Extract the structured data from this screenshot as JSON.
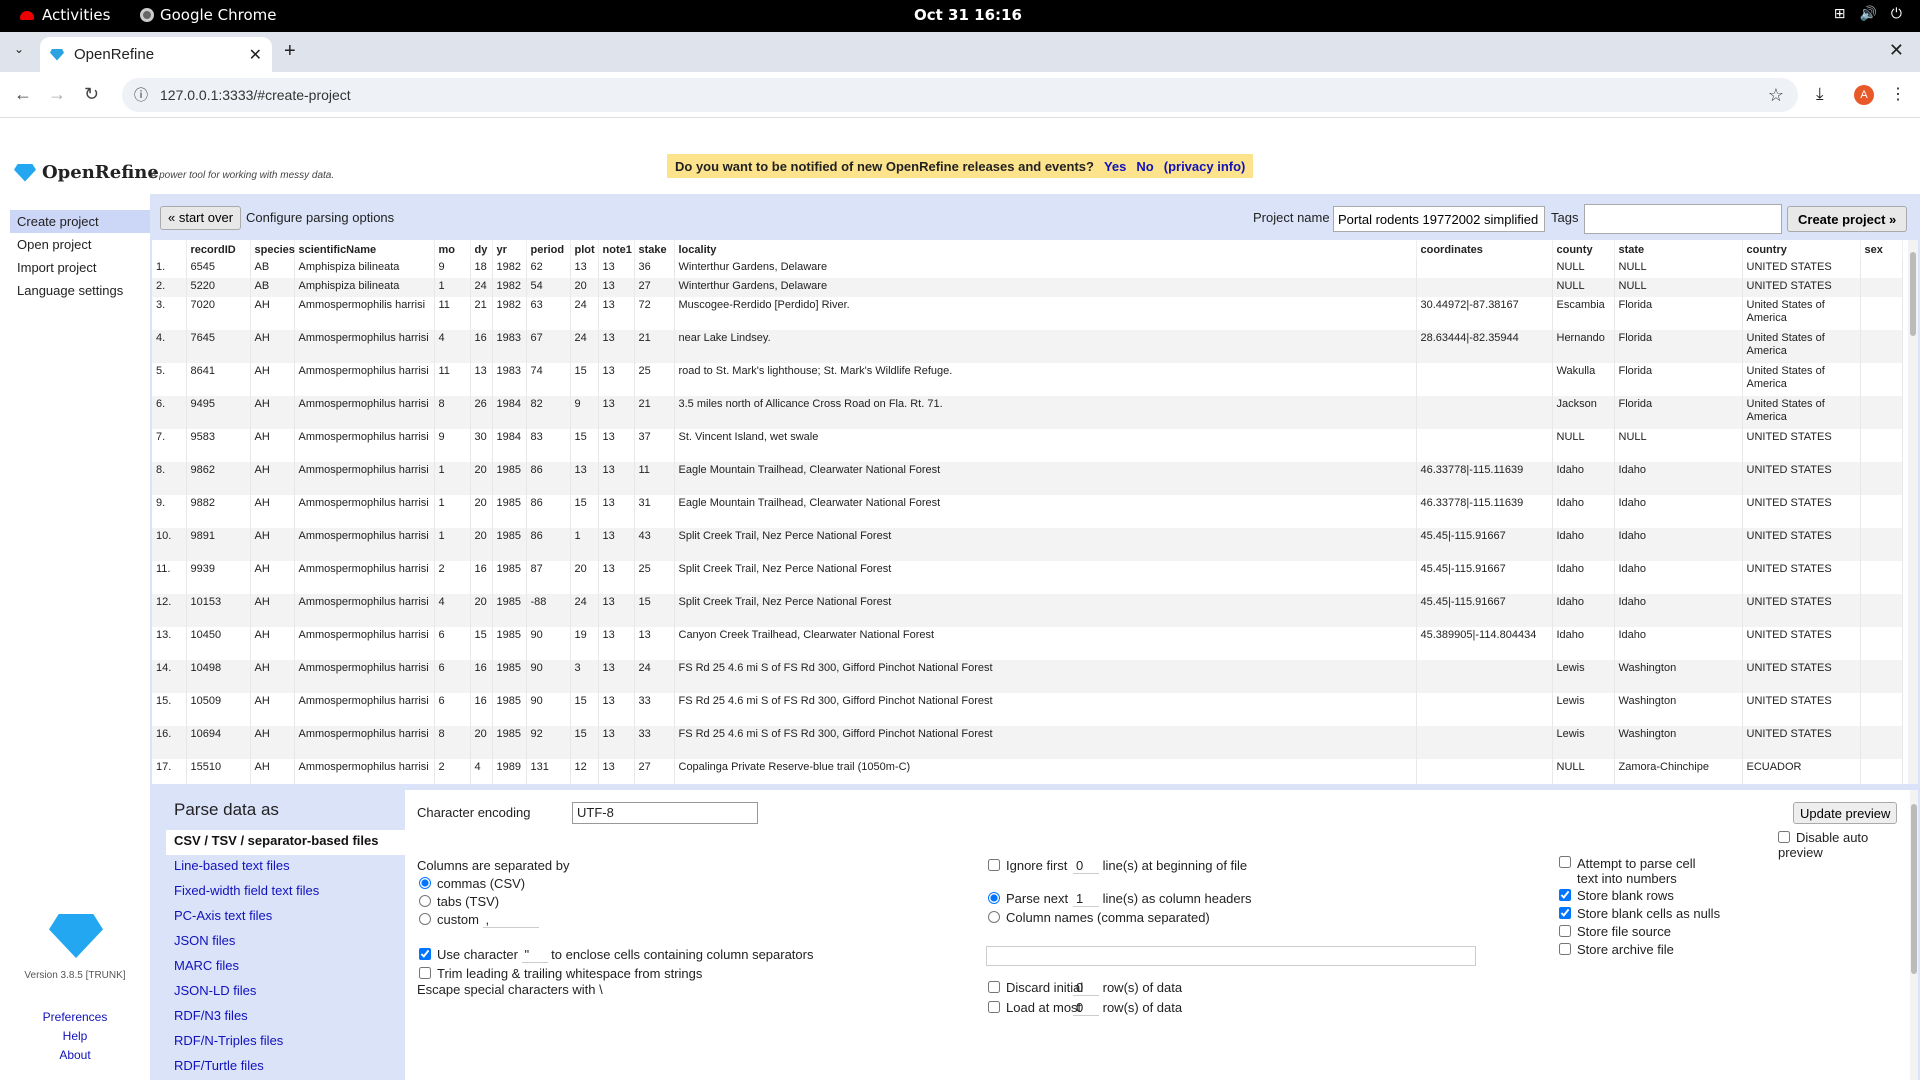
{
  "gnome": {
    "activities": "Activities",
    "app": "Google Chrome",
    "clock": "Oct 31  16:16"
  },
  "browser": {
    "tab_title": "OpenRefine",
    "url": "127.0.0.1:3333/#create-project"
  },
  "app": {
    "name": "OpenRefine",
    "tagline": "A power tool for working with messy data.",
    "notify_text": "Do you want to be notified of new OpenRefine releases and events?",
    "notify_yes": "Yes",
    "notify_no": "No",
    "notify_privacy": "(privacy info)"
  },
  "sidebar": {
    "items": [
      "Create project",
      "Open project",
      "Import project",
      "Language settings"
    ],
    "version": "Version 3.8.5 [TRUNK]",
    "links": [
      "Preferences",
      "Help",
      "About"
    ]
  },
  "config": {
    "start_over": "« start over",
    "title": "Configure parsing options",
    "project_name_label": "Project name",
    "project_name": "Portal rodents 19772002 simplified",
    "tags_label": "Tags",
    "create_button": "Create project »"
  },
  "table": {
    "columns": [
      "",
      "recordID",
      "species",
      "scientificName",
      "mo",
      "dy",
      "yr",
      "period",
      "plot",
      "note1",
      "stake",
      "locality",
      "coordinates",
      "county",
      "state",
      "country",
      "sex"
    ],
    "rows": [
      [
        "1.",
        "6545",
        "AB",
        "Amphispiza bilineata",
        "9",
        "18",
        "1982",
        "62",
        "13",
        "13",
        "36",
        "Winterthur Gardens, Delaware",
        "",
        "NULL",
        "NULL",
        "UNITED STATES",
        ""
      ],
      [
        "2.",
        "5220",
        "AB",
        "Amphispiza bilineata",
        "1",
        "24",
        "1982",
        "54",
        "20",
        "13",
        "27",
        "Winterthur Gardens, Delaware",
        "",
        "NULL",
        "NULL",
        "UNITED STATES",
        ""
      ],
      [
        "3.",
        "7020",
        "AH",
        "Ammospermophilis harrisi",
        "11",
        "21",
        "1982",
        "63",
        "24",
        "13",
        "72",
        "Muscogee-Rerdido [Perdido] River.",
        "30.44972|-87.38167",
        "Escambia",
        "Florida",
        "United States of America",
        ""
      ],
      [
        "4.",
        "7645",
        "AH",
        "Ammospermophilus harrisi",
        "4",
        "16",
        "1983",
        "67",
        "24",
        "13",
        "21",
        "near Lake Lindsey.",
        "28.63444|-82.35944",
        "Hernando",
        "Florida",
        "United States of America",
        ""
      ],
      [
        "5.",
        "8641",
        "AH",
        "Ammospermophilus harrisi",
        "11",
        "13",
        "1983",
        "74",
        "15",
        "13",
        "25",
        "road to St. Mark's lighthouse; St. Mark's Wildlife Refuge.",
        "",
        "Wakulla",
        "Florida",
        "United States of America",
        ""
      ],
      [
        "6.",
        "9495",
        "AH",
        "Ammospermophilus harrisi",
        "8",
        "26",
        "1984",
        "82",
        "9",
        "13",
        "21",
        "3.5 miles north of Allicance Cross Road on Fla. Rt. 71.",
        "",
        "Jackson",
        "Florida",
        "United States of America",
        ""
      ],
      [
        "7.",
        "9583",
        "AH",
        "Ammospermophilus harrisi",
        "9",
        "30",
        "1984",
        "83",
        "15",
        "13",
        "37",
        "St. Vincent Island, wet swale",
        "",
        "NULL",
        "NULL",
        "UNITED STATES",
        ""
      ],
      [
        "8.",
        "9862",
        "AH",
        "Ammospermophilus harrisi",
        "1",
        "20",
        "1985",
        "86",
        "13",
        "13",
        "11",
        "Eagle Mountain Trailhead, Clearwater National Forest",
        "46.33778|-115.11639",
        "Idaho",
        "Idaho",
        "UNITED STATES",
        ""
      ],
      [
        "9.",
        "9882",
        "AH",
        "Ammospermophilus harrisi",
        "1",
        "20",
        "1985",
        "86",
        "15",
        "13",
        "31",
        "Eagle Mountain Trailhead, Clearwater National Forest",
        "46.33778|-115.11639",
        "Idaho",
        "Idaho",
        "UNITED STATES",
        ""
      ],
      [
        "10.",
        "9891",
        "AH",
        "Ammospermophilus harrisi",
        "1",
        "20",
        "1985",
        "86",
        "1",
        "13",
        "43",
        "Split Creek Trail, Nez Perce National Forest",
        "45.45|-115.91667",
        "Idaho",
        "Idaho",
        "UNITED STATES",
        ""
      ],
      [
        "11.",
        "9939",
        "AH",
        "Ammospermophilus harrisi",
        "2",
        "16",
        "1985",
        "87",
        "20",
        "13",
        "25",
        "Split Creek Trail, Nez Perce National Forest",
        "45.45|-115.91667",
        "Idaho",
        "Idaho",
        "UNITED STATES",
        ""
      ],
      [
        "12.",
        "10153",
        "AH",
        "Ammospermophilus harrisi",
        "4",
        "20",
        "1985",
        "-88",
        "24",
        "13",
        "15",
        "Split Creek Trail, Nez Perce National Forest",
        "45.45|-115.91667",
        "Idaho",
        "Idaho",
        "UNITED STATES",
        ""
      ],
      [
        "13.",
        "10450",
        "AH",
        "Ammospermophilus harrisi",
        "6",
        "15",
        "1985",
        "90",
        "19",
        "13",
        "13",
        "Canyon Creek Trailhead, Clearwater National Forest",
        "45.389905|-114.804434",
        "Idaho",
        "Idaho",
        "UNITED STATES",
        ""
      ],
      [
        "14.",
        "10498",
        "AH",
        "Ammospermophilus harrisi",
        "6",
        "16",
        "1985",
        "90",
        "3",
        "13",
        "24",
        "FS Rd 25 4.6 mi S of FS Rd 300, Gifford Pinchot National Forest",
        "",
        "Lewis",
        "Washington",
        "UNITED STATES",
        ""
      ],
      [
        "15.",
        "10509",
        "AH",
        "Ammospermophilus harrisi",
        "6",
        "16",
        "1985",
        "90",
        "15",
        "13",
        "33",
        "FS Rd 25 4.6 mi S of FS Rd 300, Gifford Pinchot National Forest",
        "",
        "Lewis",
        "Washington",
        "UNITED STATES",
        ""
      ],
      [
        "16.",
        "10694",
        "AH",
        "Ammospermophilus harrisi",
        "8",
        "20",
        "1985",
        "92",
        "15",
        "13",
        "33",
        "FS Rd 25 4.6 mi S of FS Rd 300, Gifford Pinchot National Forest",
        "",
        "Lewis",
        "Washington",
        "UNITED STATES",
        ""
      ],
      [
        "17.",
        "15510",
        "AH",
        "Ammospermophilus harrisi",
        "2",
        "4",
        "1989",
        "131",
        "12",
        "13",
        "27",
        "Copalinga Private Reserve-blue trail (1050m-C)",
        "",
        "NULL",
        "Zamora-Chinchipe",
        "ECUADOR",
        ""
      ]
    ]
  },
  "parse": {
    "title": "Parse data as",
    "formats": [
      "CSV / TSV / separator-based files",
      "Line-based text files",
      "Fixed-width field text files",
      "PC-Axis text files",
      "JSON files",
      "MARC files",
      "JSON-LD files",
      "RDF/N3 files",
      "RDF/N-Triples files",
      "RDF/Turtle files"
    ],
    "encoding_label": "Character encoding",
    "encoding": "UTF-8",
    "update_preview": "Update preview",
    "disable_auto_preview": "Disable auto preview",
    "columns_sep_label": "Columns are separated by",
    "sep_commas": "commas (CSV)",
    "sep_tabs": "tabs (TSV)",
    "sep_custom": "custom",
    "custom_value": ",",
    "use_char": "Use character",
    "quote_char": "\"",
    "enclose_text": "to enclose cells containing column separators",
    "trim": "Trim leading & trailing whitespace from strings",
    "escape": "Escape special characters with \\",
    "ignore_first": "Ignore first",
    "ignore_value": "0",
    "ignore_suffix": "line(s) at beginning of file",
    "parse_next": "Parse next",
    "parse_value": "1",
    "parse_suffix": "line(s) as column headers",
    "column_names": "Column names (comma separated)",
    "discard_initial": "Discard initial",
    "discard_value": "0",
    "discard_suffix": "row(s) of data",
    "load_at_most": "Load at most",
    "load_value": "0",
    "load_suffix": "row(s) of data",
    "attempt_parse": "Attempt to parse cell text into numbers",
    "store_blank_rows": "Store blank rows",
    "store_blank_nulls": "Store blank cells as nulls",
    "store_file_source": "Store file source",
    "store_archive_file": "Store archive file"
  }
}
